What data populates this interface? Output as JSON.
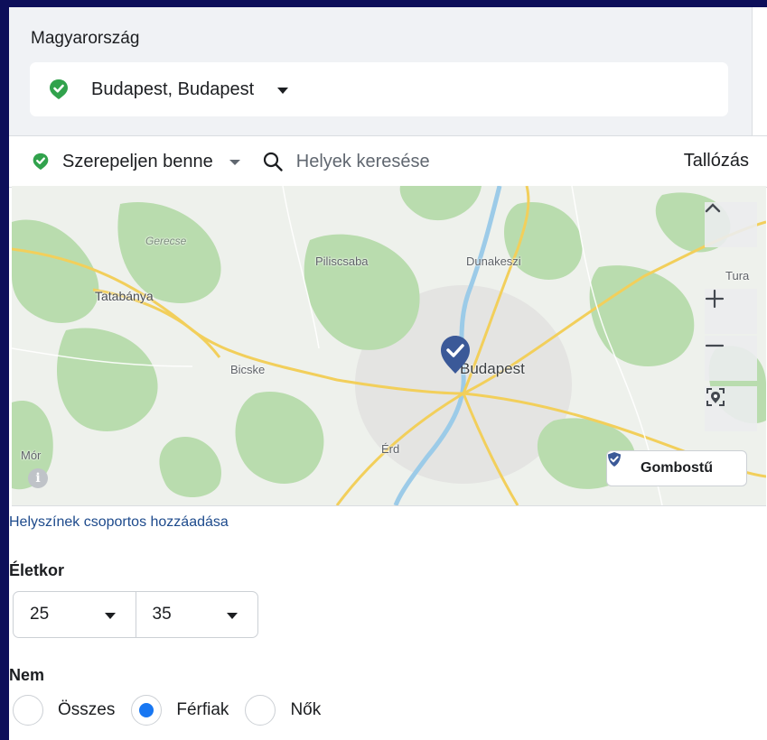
{
  "location": {
    "country": "Magyarország",
    "selected": "Budapest, Budapest",
    "pin_color": "#31a24c"
  },
  "toolbar": {
    "include_label": "Szerepeljen benne",
    "search_placeholder": "Helyek keresése",
    "browse_label": "Tallózás"
  },
  "map": {
    "labels": {
      "gerecse": "Gerecse",
      "piliscsaba": "Piliscsaba",
      "dunakeszi": "Dunakeszi",
      "tura": "Tura",
      "tatabanya": "Tatabánya",
      "bicske": "Bicske",
      "budapest": "Budapest",
      "erd": "Érd",
      "mor": "Mór"
    },
    "pin_button_label": "Gombostű",
    "marker_color": "#3b5998"
  },
  "bulk_link": "Helyszínek csoportos hozzáadása",
  "age": {
    "title": "Életkor",
    "min": "25",
    "max": "35"
  },
  "gender": {
    "title": "Nem",
    "options": [
      "Összes",
      "Férfiak",
      "Nők"
    ],
    "selected_index": 1,
    "accent": "#1877f2"
  }
}
